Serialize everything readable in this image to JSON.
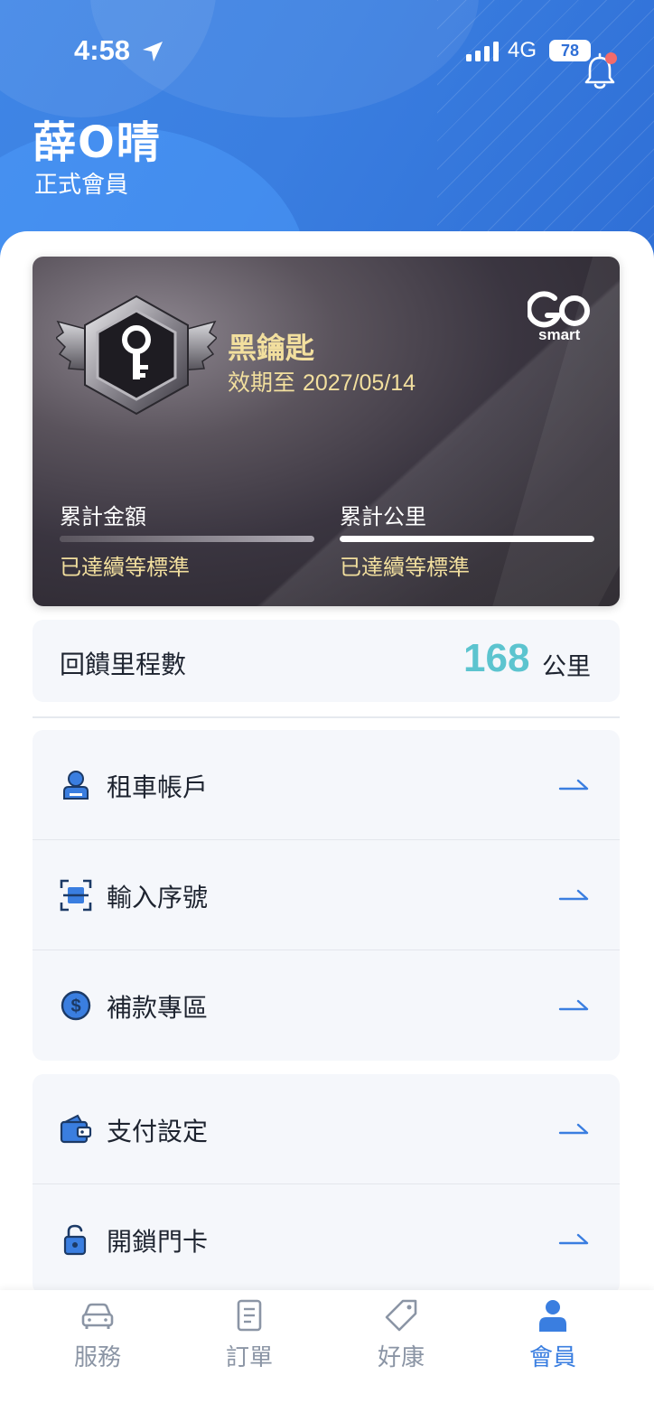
{
  "status_bar": {
    "time": "4:58",
    "network": "4G",
    "battery": "78"
  },
  "header": {
    "user_name": "薛O晴",
    "member_level": "正式會員"
  },
  "card": {
    "tier_name": "黑鑰匙",
    "expiry_label": "效期至",
    "expiry_date": "2027/05/14",
    "brand_logo": "GO smart",
    "metrics": [
      {
        "label": "累計金額",
        "status": "已達續等標準",
        "progress": 1.0
      },
      {
        "label": "累計公里",
        "status": "已達續等標準",
        "progress": 1.0
      }
    ]
  },
  "mileage": {
    "label": "回饋里程數",
    "value": "168",
    "unit": "公里"
  },
  "menu_groups": [
    [
      {
        "label": "租車帳戶",
        "icon": "user-account-icon"
      },
      {
        "label": "輸入序號",
        "icon": "scan-code-icon"
      },
      {
        "label": "補款專區",
        "icon": "dollar-coin-icon"
      }
    ],
    [
      {
        "label": "支付設定",
        "icon": "wallet-icon"
      },
      {
        "label": "開鎖門卡",
        "icon": "unlock-icon"
      }
    ]
  ],
  "tabbar": [
    {
      "label": "服務",
      "icon": "car-icon",
      "active": false
    },
    {
      "label": "訂單",
      "icon": "document-icon",
      "active": false
    },
    {
      "label": "好康",
      "icon": "tag-icon",
      "active": false
    },
    {
      "label": "會員",
      "icon": "person-icon",
      "active": true
    }
  ],
  "colors": {
    "header_blue": "#3a7ee0",
    "accent_blue": "#3a7ee0",
    "gold_text": "#f2df9e",
    "mileage_teal": "#5cc4cf",
    "notification_dot": "#f26b6b"
  }
}
